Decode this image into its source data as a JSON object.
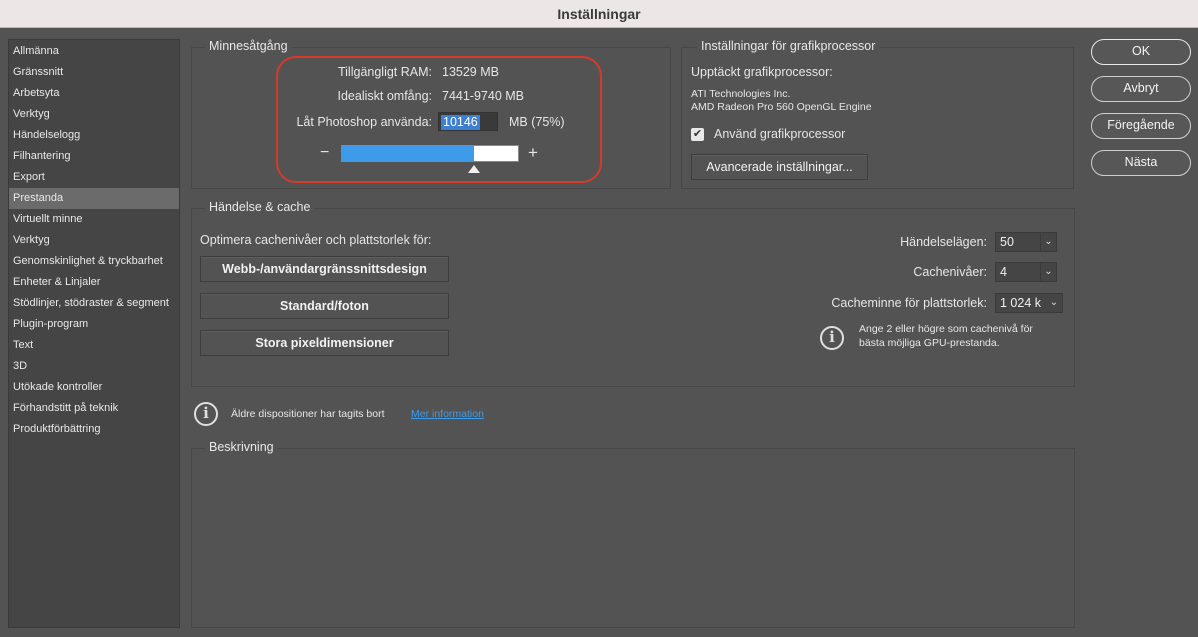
{
  "window": {
    "title": "Inställningar"
  },
  "sidebar": {
    "items": [
      {
        "label": "Allmänna"
      },
      {
        "label": "Gränssnitt"
      },
      {
        "label": "Arbetsyta"
      },
      {
        "label": "Verktyg"
      },
      {
        "label": "Händelselogg"
      },
      {
        "label": "Filhantering"
      },
      {
        "label": "Export"
      },
      {
        "label": "Prestanda",
        "selected": true
      },
      {
        "label": "Virtuellt minne"
      },
      {
        "label": "Verktyg"
      },
      {
        "label": "Genomskinlighet & tryckbarhet"
      },
      {
        "label": "Enheter & Linjaler"
      },
      {
        "label": "Stödlinjer, stödraster & segment"
      },
      {
        "label": "Plugin-program"
      },
      {
        "label": "Text"
      },
      {
        "label": "3D"
      },
      {
        "label": "Utökade kontroller"
      },
      {
        "label": "Förhandstitt på teknik"
      },
      {
        "label": "Produktförbättring"
      }
    ]
  },
  "memory": {
    "title": "Minnesåtgång",
    "available_label": "Tillgängligt RAM:",
    "available_value": "13529 MB",
    "ideal_label": "Idealiskt omfång:",
    "ideal_value": "7441-9740 MB",
    "use_label": "Låt Photoshop använda:",
    "use_value": "10146",
    "use_unit": "MB (75%)",
    "minus": "−",
    "plus": "+",
    "slider_percent": 75
  },
  "gpu": {
    "title": "Inställningar för grafikprocessor",
    "detected_label": "Upptäckt grafikprocessor:",
    "vendor": "ATI Technologies Inc.",
    "renderer": "AMD Radeon Pro 560 OpenGL Engine",
    "use_gpu_label": "Använd grafikprocessor",
    "use_gpu_checked": true,
    "advanced_button": "Avancerade inställningar..."
  },
  "cache": {
    "title": "Händelse & cache",
    "optimize_label": "Optimera cachenivåer och plattstorlek för:",
    "buttons": [
      "Webb-/användargränssnittsdesign",
      "Standard/foton",
      "Stora pixeldimensioner"
    ],
    "history_label": "Händelselägen:",
    "history_value": "50",
    "levels_label": "Cachenivåer:",
    "levels_value": "4",
    "tile_label": "Cacheminne för plattstorlek:",
    "tile_value": "1 024 k",
    "info_line1": "Ange 2 eller högre som cachenivå för",
    "info_line2": "bästa möjliga GPU-prestanda."
  },
  "legacy": {
    "text": "Äldre dispositioner har tagits bort",
    "link": "Mer information"
  },
  "description": {
    "title": "Beskrivning"
  },
  "dialog_buttons": {
    "ok": "OK",
    "cancel": "Avbryt",
    "previous": "Föregående",
    "next": "Nästa"
  },
  "colors": {
    "accent": "#3e9be9",
    "highlight_ring": "#d63b2a",
    "link": "#3e9be9"
  }
}
